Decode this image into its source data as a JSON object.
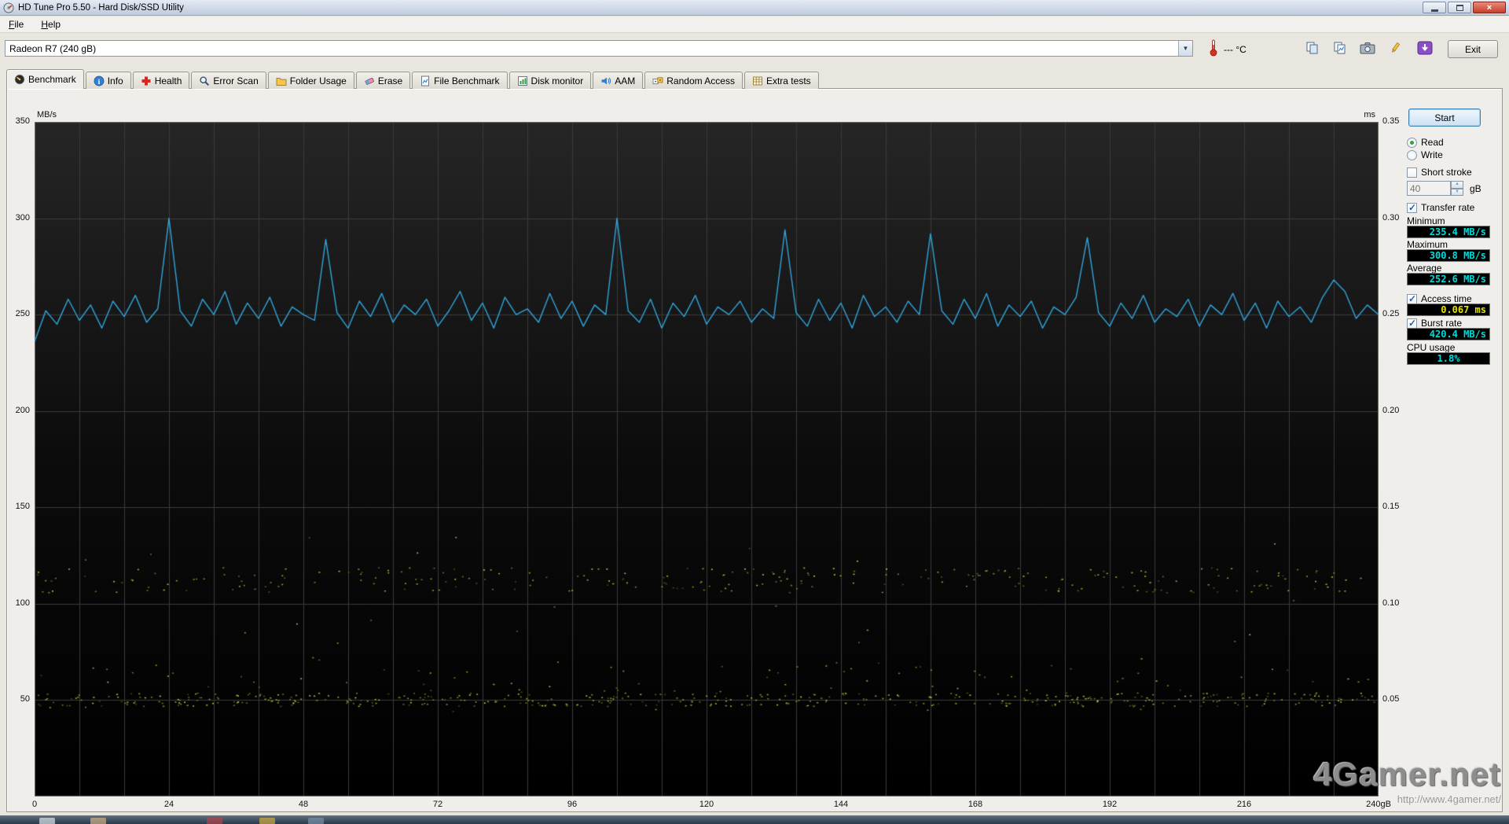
{
  "window": {
    "title": "HD Tune Pro 5.50 - Hard Disk/SSD Utility"
  },
  "menu": {
    "items": [
      "File",
      "Help"
    ]
  },
  "toolbar": {
    "drive_selector": "Radeon R7 (240 gB)",
    "temperature": "--- °C",
    "exit_label": "Exit"
  },
  "icons": {
    "app": "hd-tune-app-icon",
    "temperature": "thermometer-icon",
    "combo": "chevron-down-icon",
    "toolbar": [
      "copy-pages-icon",
      "copy-report-icon",
      "camera-icon",
      "pen-icon",
      "download-icon"
    ],
    "tabs": [
      "benchmark-icon",
      "info-icon",
      "health-icon",
      "error-scan-icon",
      "folder-usage-icon",
      "erase-icon",
      "file-benchmark-icon",
      "disk-monitor-icon",
      "aam-icon",
      "random-access-icon",
      "extra-tests-icon"
    ]
  },
  "tabs": [
    {
      "label": "Benchmark",
      "active": true
    },
    {
      "label": "Info",
      "active": false
    },
    {
      "label": "Health",
      "active": false
    },
    {
      "label": "Error Scan",
      "active": false
    },
    {
      "label": "Folder Usage",
      "active": false
    },
    {
      "label": "Erase",
      "active": false
    },
    {
      "label": "File Benchmark",
      "active": false
    },
    {
      "label": "Disk monitor",
      "active": false
    },
    {
      "label": "AAM",
      "active": false
    },
    {
      "label": "Random Access",
      "active": false
    },
    {
      "label": "Extra tests",
      "active": false
    }
  ],
  "controls": {
    "start_label": "Start",
    "read_label": "Read",
    "read_selected": true,
    "write_label": "Write",
    "write_selected": false,
    "short_stroke_label": "Short stroke",
    "short_stroke_checked": false,
    "short_stroke_value": "40",
    "short_stroke_unit": "gB",
    "transfer_rate_label": "Transfer rate",
    "transfer_rate_checked": true,
    "minimum_label": "Minimum",
    "minimum_value": "235.4 MB/s",
    "maximum_label": "Maximum",
    "maximum_value": "300.8 MB/s",
    "average_label": "Average",
    "average_value": "252.6 MB/s",
    "access_time_label": "Access time",
    "access_time_checked": true,
    "access_time_value": "0.067 ms",
    "burst_rate_label": "Burst rate",
    "burst_rate_checked": true,
    "burst_rate_value": "420.4 MB/s",
    "cpu_usage_label": "CPU usage",
    "cpu_usage_value": "1.8%"
  },
  "watermark": {
    "logo": "4Gamer.net",
    "url": "http://www.4gamer.net/"
  },
  "chart_data": {
    "type": "line",
    "ylabel_left": "MB/s",
    "ylabel_right": "ms",
    "xlim": [
      0,
      240
    ],
    "ylim_left": [
      0,
      350
    ],
    "ylim_right": [
      0,
      0.35
    ],
    "x_grid_step": 8,
    "x_tick_step": 24,
    "y_tick_step": 50,
    "x_tick_labels": [
      "0",
      "24",
      "48",
      "72",
      "96",
      "120",
      "144",
      "168",
      "192",
      "216",
      "240gB"
    ],
    "y_ticks_left": [
      "350",
      "300",
      "250",
      "200",
      "150",
      "100",
      "50"
    ],
    "y_ticks_right": [
      "0.35",
      "0.30",
      "0.25",
      "0.20",
      "0.15",
      "0.10",
      "0.05"
    ],
    "grid_color": "#3a3a3a",
    "bg_gradient": [
      "#262626",
      "#0c0c0c",
      "#000000"
    ],
    "series": [
      {
        "name": "Transfer rate (read)",
        "unit": "MB/s",
        "color": "#30a4dc",
        "x_start": 0,
        "x_step": 2,
        "values": [
          236,
          252,
          245,
          258,
          247,
          255,
          243,
          257,
          249,
          260,
          246,
          253,
          300,
          252,
          244,
          258,
          250,
          262,
          245,
          256,
          248,
          259,
          244,
          254,
          250,
          247,
          289,
          251,
          243,
          257,
          249,
          261,
          246,
          255,
          250,
          258,
          244,
          252,
          262,
          247,
          256,
          243,
          259,
          250,
          253,
          246,
          261,
          248,
          257,
          244,
          255,
          250,
          300,
          252,
          246,
          258,
          243,
          256,
          249,
          260,
          245,
          254,
          250,
          257,
          246,
          253,
          248,
          294,
          251,
          244,
          258,
          247,
          256,
          243,
          260,
          249,
          254,
          246,
          257,
          250,
          292,
          252,
          245,
          258,
          248,
          261,
          244,
          255,
          249,
          257,
          243,
          254,
          250,
          259,
          290,
          251,
          244,
          256,
          248,
          260,
          246,
          253,
          249,
          258,
          244,
          255,
          250,
          261,
          247,
          256,
          243,
          257,
          249,
          254,
          246,
          259,
          268,
          262,
          248,
          255,
          250
        ]
      }
    ],
    "scatter": {
      "name": "Access time",
      "unit": "ms",
      "color": "#c9c93e",
      "bands": [
        {
          "y_min": 0.106,
          "y_max": 0.119,
          "count": 260,
          "seed": 7
        },
        {
          "y_min": 0.047,
          "y_max": 0.054,
          "count": 430,
          "seed": 13
        },
        {
          "y_min": 0.044,
          "y_max": 0.072,
          "count": 110,
          "seed": 21
        },
        {
          "y_min": 0.058,
          "y_max": 0.145,
          "count": 28,
          "seed": 29
        }
      ]
    }
  }
}
